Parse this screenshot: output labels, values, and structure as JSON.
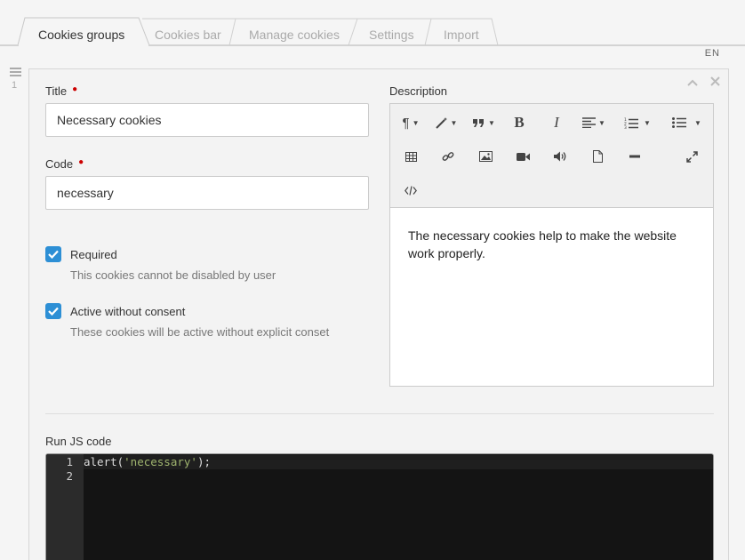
{
  "tabs": [
    {
      "label": "Cookies groups",
      "active": true
    },
    {
      "label": "Cookies bar",
      "active": false
    },
    {
      "label": "Manage cookies",
      "active": false
    },
    {
      "label": "Settings",
      "active": false
    },
    {
      "label": "Import",
      "active": false
    }
  ],
  "language": "EN",
  "row_index": "1",
  "form": {
    "title_label": "Title",
    "title_value": "Necessary cookies",
    "code_label": "Code",
    "code_value": "necessary",
    "required_label": "Required",
    "required_hint": "This cookies cannot be disabled by user",
    "required_checked": true,
    "active_label": "Active without consent",
    "active_hint": "These cookies will be active without explicit conset",
    "active_checked": true,
    "description_label": "Description",
    "description_text": "The necessary cookies help to make the website work properly.",
    "js_label": "Run JS code",
    "js_lines": [
      {
        "number": "1",
        "fn": "alert(",
        "str": "'necessary'",
        "end": ");"
      },
      {
        "number": "2",
        "fn": "",
        "str": "",
        "end": ""
      }
    ]
  },
  "toolbar_icons": [
    "paragraph-icon",
    "magic-wand-icon",
    "quote-icon",
    "bold-icon",
    "italic-icon",
    "align-icon",
    "ordered-list-icon",
    "unordered-list-icon",
    "table-icon",
    "link-icon",
    "image-icon",
    "video-icon",
    "audio-icon",
    "file-icon",
    "horizontal-rule-icon",
    "fullscreen-icon",
    "code-view-icon"
  ],
  "colors": {
    "accent": "#2d8fd5",
    "required_marker": "#cc0000",
    "code_background": "#141414",
    "code_string": "#9fb46e"
  }
}
